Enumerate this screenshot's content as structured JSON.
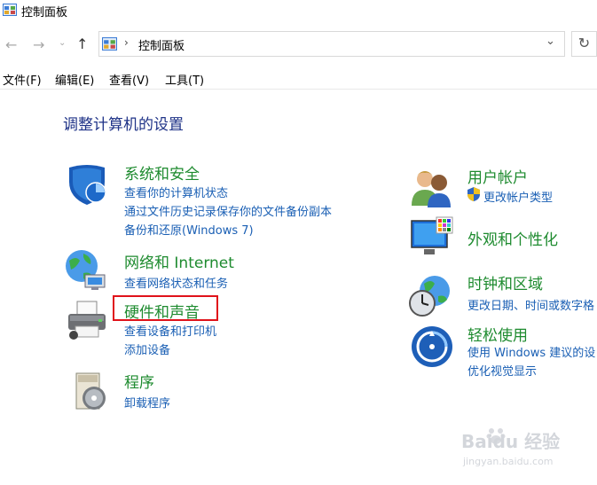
{
  "window": {
    "title": "控制面板"
  },
  "address": {
    "path": "控制面板"
  },
  "menu": [
    "文件(F)",
    "编辑(E)",
    "查看(V)",
    "工具(T)"
  ],
  "heading": "调整计算机的设置",
  "categories": {
    "system": {
      "title": "系统和安全",
      "links": [
        "查看你的计算机状态",
        "通过文件历史记录保存你的文件备份副本",
        "备份和还原(Windows 7)"
      ],
      "icon": "shield-icon"
    },
    "network": {
      "title": "网络和 Internet",
      "links": [
        "查看网络状态和任务"
      ],
      "icon": "network-globe-icon"
    },
    "hardware": {
      "title": "硬件和声音",
      "links": [
        "查看设备和打印机",
        "添加设备"
      ],
      "icon": "printer-icon"
    },
    "programs": {
      "title": "程序",
      "links": [
        "卸载程序"
      ],
      "icon": "programs-disc-icon"
    },
    "user": {
      "title": "用户帐户",
      "links": [
        "更改帐户类型"
      ],
      "icon": "users-icon"
    },
    "appearance": {
      "title": "外观和个性化",
      "links": [],
      "icon": "monitor-palette-icon"
    },
    "clock": {
      "title": "时钟和区域",
      "links": [
        "更改日期、时间或数字格"
      ],
      "icon": "clock-globe-icon"
    },
    "ease": {
      "title": "轻松使用",
      "links": [
        "使用 Windows 建议的设",
        "优化视觉显示"
      ],
      "icon": "ease-of-access-icon"
    }
  },
  "watermark": {
    "brand": "Baidu 经验",
    "url": "jingyan.baidu.com"
  },
  "colors": {
    "category_title": "#1e8b2f",
    "link": "#1a5fb4",
    "heading": "#1e3287",
    "highlight": "#e0121a"
  }
}
